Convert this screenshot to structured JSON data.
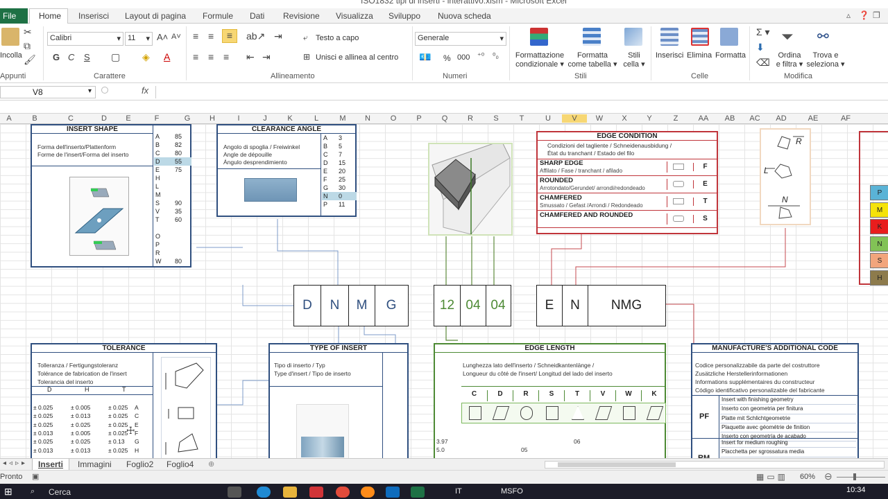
{
  "window": {
    "title": "ISO1832 tipi di inserti - interattivo.xlsm - Microsoft Excel"
  },
  "ribbon_tabs": [
    "File",
    "Home",
    "Inserisci",
    "Layout di pagina",
    "Formule",
    "Dati",
    "Revisione",
    "Visualizza",
    "Sviluppo",
    "Nuova scheda"
  ],
  "ribbon": {
    "paste": "Incolla",
    "clipboard_group": "Appunti",
    "font_name": "Calibri",
    "font_size": "11",
    "font_group": "Carattere",
    "bold": "G",
    "italic": "C",
    "underline": "S",
    "wrap_text": "Testo a capo",
    "merge_center": "Unisci e allinea al centro",
    "alignment_group": "Allineamento",
    "number_format": "Generale",
    "percent": "%",
    "thousands": "000",
    "number_group": "Numeri",
    "cond_format": [
      "Formattazione",
      "condizionale"
    ],
    "format_table": [
      "Formatta",
      "come tabella"
    ],
    "cell_styles": [
      "Stili",
      "cella"
    ],
    "styles_group": "Stili",
    "insert": "Inserisci",
    "delete": "Elimina",
    "format": "Formatta",
    "cells_group": "Celle",
    "sort_filter": [
      "Ordina",
      "e filtra"
    ],
    "find_select": [
      "Trova e",
      "seleziona"
    ],
    "editing_group": "Modifica"
  },
  "formula_bar": {
    "name_box": "V8",
    "fx": "fx"
  },
  "columns": [
    "A",
    "B",
    "C",
    "D",
    "E",
    "F",
    "G",
    "H",
    "I",
    "J",
    "K",
    "L",
    "M",
    "N",
    "O",
    "P",
    "Q",
    "R",
    "S",
    "T",
    "U",
    "V",
    "W",
    "X",
    "Y",
    "Z",
    "AA",
    "AB",
    "AC",
    "AD",
    "AE",
    "AF"
  ],
  "insert_shape": {
    "title": "INSERT SHAPE",
    "desc": [
      "Forma dell'inserto/Plattenform",
      "Forme de l'insert/Forma del inserto"
    ],
    "rows": [
      [
        "A",
        "85"
      ],
      [
        "B",
        "82"
      ],
      [
        "C",
        "80"
      ],
      [
        "D",
        "55"
      ],
      [
        "E",
        "75"
      ],
      [
        "H",
        ""
      ],
      [
        "L",
        ""
      ],
      [
        "M",
        ""
      ],
      [
        "S",
        "90"
      ],
      [
        "V",
        "35"
      ],
      [
        "T",
        "60"
      ],
      [
        "",
        ""
      ],
      [
        "O",
        ""
      ],
      [
        "P",
        ""
      ],
      [
        "R",
        ""
      ],
      [
        "W",
        "80"
      ]
    ]
  },
  "clearance": {
    "title": "CLEARANCE ANGLE",
    "desc": [
      "Angolo di spoglia / Freiwinkel",
      "Angle de dépouille",
      "Ángulo desprendimiento"
    ],
    "rows": [
      [
        "A",
        "3"
      ],
      [
        "B",
        "5"
      ],
      [
        "C",
        "7"
      ],
      [
        "D",
        "15"
      ],
      [
        "E",
        "20"
      ],
      [
        "F",
        "25"
      ],
      [
        "G",
        "30"
      ],
      [
        "N",
        "0"
      ],
      [
        "P",
        "11"
      ]
    ]
  },
  "edge_condition": {
    "title": "EDGE CONDITION",
    "desc": [
      "Condizioni del tagliente / Schneidenausbidung /",
      "État du tranchant / Estado del filo"
    ],
    "items": [
      {
        "name": "SHARP EDGE",
        "sub": "Affilato / Fase / tranchant / afilado",
        "code": "F"
      },
      {
        "name": "ROUNDED",
        "sub": "Arrotondato/Gerundet/ arrondi/redondeado",
        "code": "E"
      },
      {
        "name": "CHAMFERED",
        "sub": "Smussato / Gefast /Arrondi / Redondeado",
        "code": "T"
      },
      {
        "name": "CHAMFERED AND ROUNDED",
        "sub": "",
        "code": "S"
      }
    ]
  },
  "direction": {
    "r": "R",
    "l": "L",
    "n": "N"
  },
  "iso_codes": {
    "group1": [
      "D",
      "N",
      "M",
      "G"
    ],
    "group2": [
      "12",
      "04",
      "04"
    ],
    "group3": [
      "E",
      "N",
      "NMG"
    ]
  },
  "material_codes": [
    "P",
    "M",
    "K",
    "N",
    "S",
    "H"
  ],
  "tolerance": {
    "title": "TOLERANCE",
    "desc": [
      "Tolleranza / Fertigungstoleranz",
      "Tolérance de fabrication de l'insert",
      "Tolerancia del inserto"
    ],
    "headers": [
      "D",
      "H",
      "T"
    ],
    "rows": [
      [
        "± 0.025",
        "± 0.005",
        "± 0.025",
        "A"
      ],
      [
        "± 0.025",
        "± 0.013",
        "± 0.025",
        "C"
      ],
      [
        "± 0.025",
        "± 0.025",
        "± 0.025",
        "E"
      ],
      [
        "± 0.013",
        "± 0.005",
        "± 0.025",
        "F"
      ],
      [
        "± 0.025",
        "± 0.025",
        "± 0.13",
        "G"
      ],
      [
        "± 0.013",
        "± 0.013",
        "± 0.025",
        "H"
      ]
    ]
  },
  "type_of_insert": {
    "title": "TYPE OF INSERT",
    "desc": [
      "Tipo di inserto / Typ",
      "Type d'insert / Tipo de inserto"
    ]
  },
  "edge_length": {
    "title": "EDGE LENGTH",
    "desc": [
      "Lunghezza lato dell'inserto / Schneidkantenlänge /",
      "Longueur du côté de l'insert/ Longitud del lado del inserto"
    ],
    "shapes": [
      "C",
      "D",
      "R",
      "S",
      "T",
      "V",
      "W",
      "K"
    ],
    "values": [
      "3.97",
      "5.0"
    ],
    "mid": [
      "05",
      "06"
    ]
  },
  "manufacturer": {
    "title": "MANUFACTURE'S ADDITIONAL CODE",
    "desc": [
      "Codice personalizzabile da parte del costruttore",
      "Zusätzliche Herstellerinformationen",
      "Informations supplémentaires du constructeur",
      "Código identificativo personalizable del fabricante"
    ],
    "pf_code": "PF",
    "pf_lines": [
      "Insert with finishing geometry",
      "Inserto con geometria per finitura",
      "Platte mit Schlichtgeometrie",
      "Plaquette avec géométrie de finition",
      "Inserto con geometría de acabado"
    ],
    "rm_code": "RM",
    "rm_lines": [
      "Insert for medium roughing",
      "Placchetta per sgrossatura media"
    ]
  },
  "sheets": [
    "Inserti",
    "Immagini",
    "Foglio2",
    "Foglio4"
  ],
  "status": {
    "ready": "Pronto",
    "zoom": "60%"
  },
  "taskbar": {
    "search": "Cerca",
    "lang": "IT",
    "weather": "MSFO",
    "time": "10:34"
  },
  "colors": {
    "excel_green": "#1e7145",
    "blue_frame": "#2f4f7f",
    "green_frame": "#4d8a34",
    "red_frame": "#c0343a",
    "highlight": "#bcd9e6"
  }
}
